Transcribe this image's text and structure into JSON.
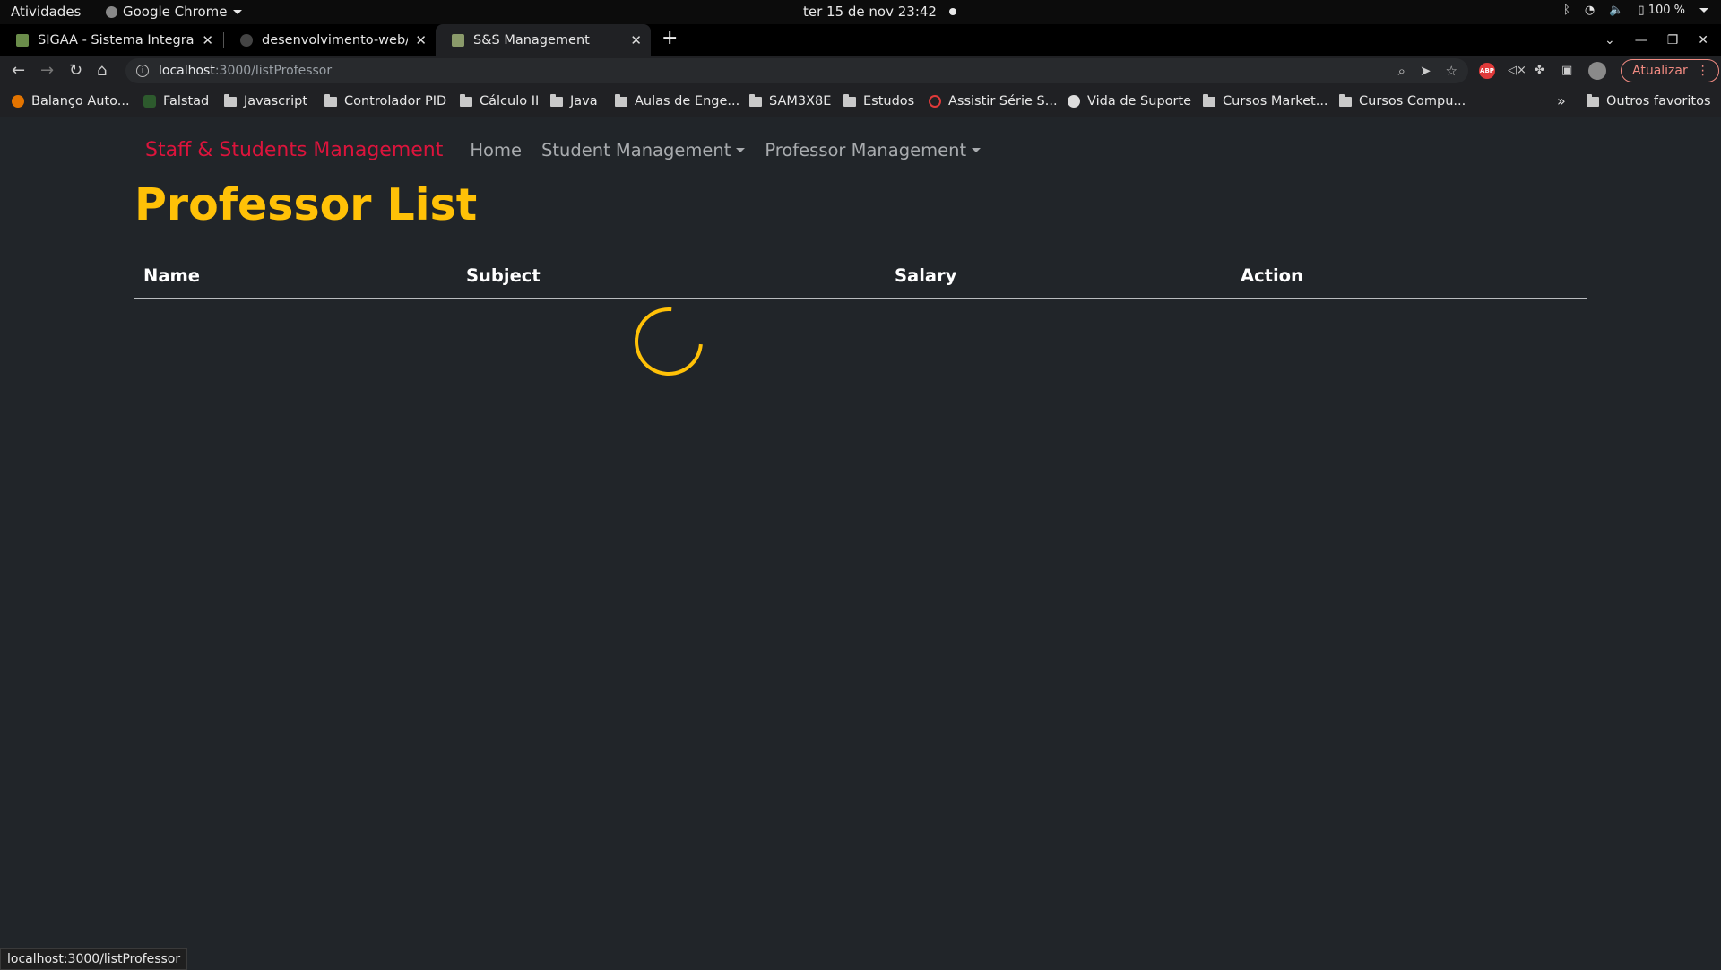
{
  "system": {
    "activities": "Atividades",
    "app_name": "Google Chrome",
    "clock": "ter 15 de nov  23:42",
    "battery": "100 %"
  },
  "browser": {
    "tabs": [
      {
        "title": "SIGAA - Sistema Integrado",
        "active": false
      },
      {
        "title": "desenvolvimento-web/crud",
        "active": false
      },
      {
        "title": "S&S Management",
        "active": true
      }
    ],
    "url_host": "localhost",
    "url_path": ":3000/listProfessor",
    "update_button": "Atualizar",
    "bookmarks": [
      {
        "label": "Balanço Auto...",
        "icon": "orange-logo-icon"
      },
      {
        "label": "Falstad",
        "icon": "falstad-icon"
      },
      {
        "label": "Javascript",
        "icon": "folder-icon"
      },
      {
        "label": "Controlador PID",
        "icon": "folder-icon"
      },
      {
        "label": "Cálculo II",
        "icon": "folder-icon"
      },
      {
        "label": "Java",
        "icon": "folder-icon"
      },
      {
        "label": "Aulas de Enge...",
        "icon": "folder-icon"
      },
      {
        "label": "SAM3X8E",
        "icon": "folder-icon"
      },
      {
        "label": "Estudos",
        "icon": "folder-icon"
      },
      {
        "label": "Assistir Série S...",
        "icon": "play-icon"
      },
      {
        "label": "Vida de Suporte",
        "icon": "skull-icon"
      },
      {
        "label": "Cursos Market...",
        "icon": "folder-icon"
      },
      {
        "label": "Cursos Compu...",
        "icon": "folder-icon"
      }
    ],
    "other_bookmarks": "Outros favoritos",
    "status_url": "localhost:3000/listProfessor"
  },
  "app": {
    "brand": "Staff & Students Management",
    "nav": {
      "home": "Home",
      "student_mgmt": "Student Management",
      "professor_mgmt": "Professor Management"
    },
    "title": "Professor List",
    "columns": [
      "Name",
      "Subject",
      "Salary",
      "Action"
    ],
    "loading": true,
    "colors": {
      "background": "#212529",
      "brand": "#dc143c",
      "title": "#ffc107",
      "spinner": "#ffc107"
    }
  }
}
